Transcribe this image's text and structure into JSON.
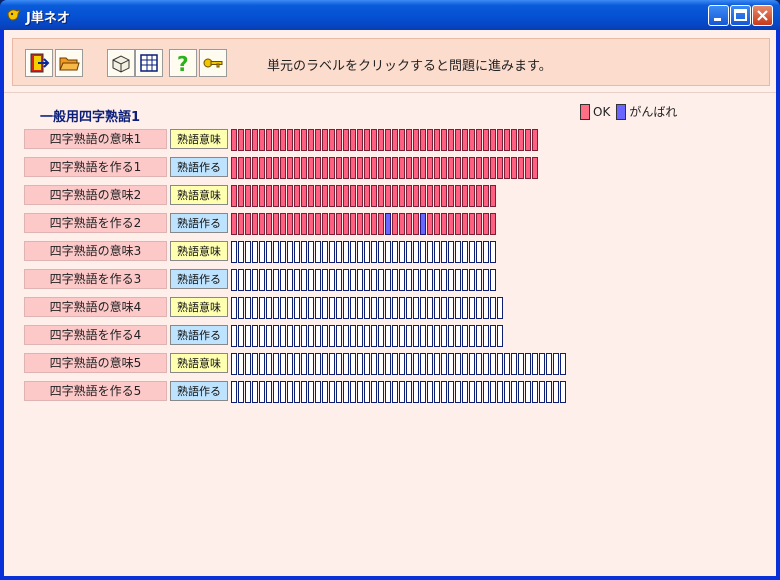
{
  "window": {
    "title": "J単ネオ"
  },
  "toolbar": {
    "hint": "単元のラベルをクリックすると問題に進みます。",
    "icons": [
      "exit-icon",
      "open-folder-icon",
      "box-icon",
      "grid-icon",
      "help-icon",
      "key-icon"
    ]
  },
  "section": {
    "title": "一般用四字熟語1"
  },
  "legend": {
    "ok_label": "OK",
    "ng_label": "がんばれ",
    "ok_color": "#FF6F86",
    "ng_color": "#6B66FF"
  },
  "rows": [
    {
      "label": "四字熟語の意味1",
      "tag": "熟語意味",
      "kind": "imi",
      "total": 44,
      "ok": 44,
      "ng_positions": []
    },
    {
      "label": "四字熟語を作る1",
      "tag": "熟語作る",
      "kind": "tsukuru",
      "total": 44,
      "ok": 44,
      "ng_positions": []
    },
    {
      "label": "四字熟語の意味2",
      "tag": "熟語意味",
      "kind": "imi",
      "total": 38,
      "ok": 38,
      "ng_positions": []
    },
    {
      "label": "四字熟語を作る2",
      "tag": "熟語作る",
      "kind": "tsukuru",
      "total": 38,
      "ok": 38,
      "ng_positions": [
        22,
        27
      ]
    },
    {
      "label": "四字熟語の意味3",
      "tag": "熟語意味",
      "kind": "imi",
      "total": 38,
      "ok": 0,
      "ng_positions": []
    },
    {
      "label": "四字熟語を作る3",
      "tag": "熟語作る",
      "kind": "tsukuru",
      "total": 38,
      "ok": 0,
      "ng_positions": []
    },
    {
      "label": "四字熟語の意味4",
      "tag": "熟語意味",
      "kind": "imi",
      "total": 39,
      "ok": 0,
      "ng_positions": []
    },
    {
      "label": "四字熟語を作る4",
      "tag": "熟語作る",
      "kind": "tsukuru",
      "total": 39,
      "ok": 0,
      "ng_positions": []
    },
    {
      "label": "四字熟語の意味5",
      "tag": "熟語意味",
      "kind": "imi",
      "total": 48,
      "ok": 0,
      "ng_positions": []
    },
    {
      "label": "四字熟語を作る5",
      "tag": "熟語作る",
      "kind": "tsukuru",
      "total": 48,
      "ok": 0,
      "ng_positions": []
    }
  ]
}
